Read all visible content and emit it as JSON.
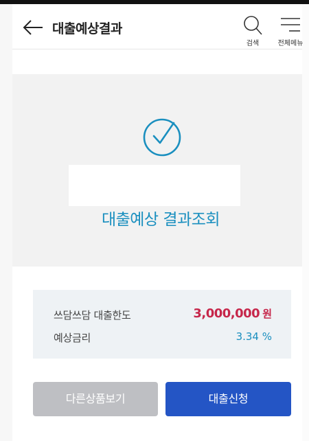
{
  "header": {
    "title": "대출예상결과",
    "search_label": "검색",
    "menu_label": "전체메뉴"
  },
  "result": {
    "title": "대출예상 결과조회"
  },
  "summary": {
    "limit_label": "쓰담쓰담 대출한도",
    "limit_amount": "3,000,000",
    "limit_unit": "원",
    "rate_label": "예상금리",
    "rate_value": "3.34 %"
  },
  "buttons": {
    "other_products": "다른상품보기",
    "apply": "대출신청"
  },
  "colors": {
    "accent_blue": "#1a8fbf",
    "amount_red": "#c6264a",
    "primary_button": "#2455c5",
    "secondary_button": "#bebfc3"
  }
}
